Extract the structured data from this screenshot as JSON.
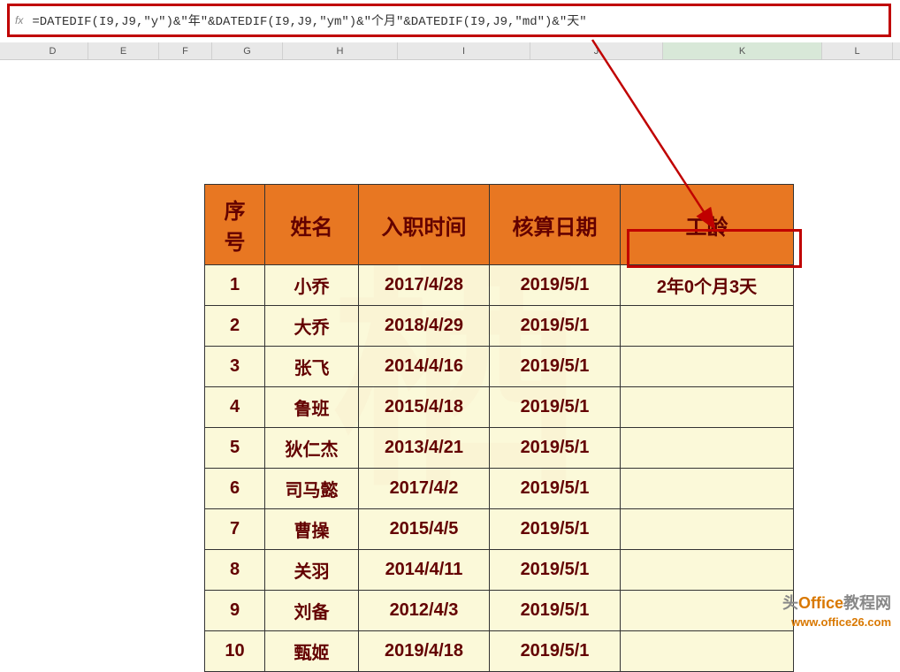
{
  "formula_bar": {
    "fx": "fx",
    "formula": "=DATEDIF(I9,J9,\"y\")&\"年\"&DATEDIF(I9,J9,\"ym\")&\"个月\"&DATEDIF(I9,J9,\"md\")&\"天\""
  },
  "columns": {
    "D": "D",
    "E": "E",
    "F": "F",
    "G": "G",
    "H": "H",
    "I": "I",
    "J": "J",
    "K": "K",
    "L": "L"
  },
  "table": {
    "headers": {
      "seq": "序号",
      "name": "姓名",
      "hire_date": "入职时间",
      "calc_date": "核算日期",
      "tenure": "工龄"
    },
    "rows": [
      {
        "seq": "1",
        "name": "小乔",
        "hire": "2017/4/28",
        "calc": "2019/5/1",
        "tenure": "2年0个月3天"
      },
      {
        "seq": "2",
        "name": "大乔",
        "hire": "2018/4/29",
        "calc": "2019/5/1",
        "tenure": ""
      },
      {
        "seq": "3",
        "name": "张飞",
        "hire": "2014/4/16",
        "calc": "2019/5/1",
        "tenure": ""
      },
      {
        "seq": "4",
        "name": "鲁班",
        "hire": "2015/4/18",
        "calc": "2019/5/1",
        "tenure": ""
      },
      {
        "seq": "5",
        "name": "狄仁杰",
        "hire": "2013/4/21",
        "calc": "2019/5/1",
        "tenure": ""
      },
      {
        "seq": "6",
        "name": "司马懿",
        "hire": "2017/4/2",
        "calc": "2019/5/1",
        "tenure": ""
      },
      {
        "seq": "7",
        "name": "曹操",
        "hire": "2015/4/5",
        "calc": "2019/5/1",
        "tenure": ""
      },
      {
        "seq": "8",
        "name": "关羽",
        "hire": "2014/4/11",
        "calc": "2019/5/1",
        "tenure": ""
      },
      {
        "seq": "9",
        "name": "刘备",
        "hire": "2012/4/3",
        "calc": "2019/5/1",
        "tenure": ""
      },
      {
        "seq": "10",
        "name": "甄姬",
        "hire": "2019/4/18",
        "calc": "2019/5/1",
        "tenure": ""
      }
    ]
  },
  "footer": {
    "logo_prefix": "头",
    "logo_main": "Office",
    "logo_suffix": "教程网",
    "url": "www.office26.com"
  }
}
